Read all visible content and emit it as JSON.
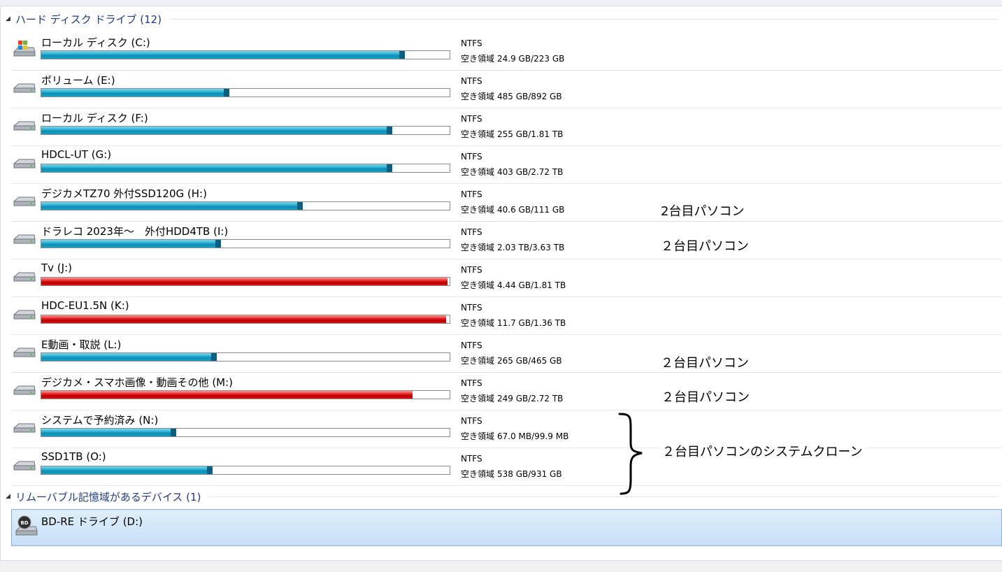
{
  "groups": {
    "hdd_header": "ハード ディスク ドライブ (12)",
    "removable_header": "リムーバブル記憶域があるデバイス (1)"
  },
  "drives": [
    {
      "name": "ローカル ディスク (C:)",
      "fs": "NTFS",
      "space_label": "空き領域",
      "space": "24.9 GB/223 GB",
      "used_fraction": 0.89,
      "color": "blue",
      "icon": "windows-drive-icon"
    },
    {
      "name": "ボリューム (E:)",
      "fs": "NTFS",
      "space_label": "空き領域",
      "space": "485 GB/892 GB",
      "used_fraction": 0.46,
      "color": "blue",
      "icon": "hard-drive-icon"
    },
    {
      "name": "ローカル ディスク (F:)",
      "fs": "NTFS",
      "space_label": "空き領域",
      "space": "255 GB/1.81 TB",
      "used_fraction": 0.86,
      "color": "blue",
      "icon": "hard-drive-icon"
    },
    {
      "name": "HDCL-UT (G:)",
      "fs": "NTFS",
      "space_label": "空き領域",
      "space": "403 GB/2.72 TB",
      "used_fraction": 0.86,
      "color": "blue",
      "icon": "hard-drive-icon"
    },
    {
      "name": "デジカメTZ70 外付SSD120G (H:)",
      "fs": "NTFS",
      "space_label": "空き領域",
      "space": "40.6 GB/111 GB",
      "used_fraction": 0.64,
      "color": "blue",
      "icon": "hard-drive-icon"
    },
    {
      "name": "ドラレコ 2023年～　外付HDD4TB (I:)",
      "fs": "NTFS",
      "space_label": "空き領域",
      "space": "2.03 TB/3.63 TB",
      "used_fraction": 0.44,
      "color": "blue",
      "icon": "hard-drive-icon"
    },
    {
      "name": "Tv (J:)",
      "fs": "NTFS",
      "space_label": "空き領域",
      "space": "4.44 GB/1.81 TB",
      "used_fraction": 0.995,
      "color": "red",
      "icon": "hard-drive-icon"
    },
    {
      "name": "HDC-EU1.5N (K:)",
      "fs": "NTFS",
      "space_label": "空き領域",
      "space": "11.7 GB/1.36 TB",
      "used_fraction": 0.992,
      "color": "red",
      "icon": "hard-drive-icon"
    },
    {
      "name": "E動画・取説 (L:)",
      "fs": "NTFS",
      "space_label": "空き領域",
      "space": "265 GB/465 GB",
      "used_fraction": 0.43,
      "color": "blue",
      "icon": "hard-drive-icon"
    },
    {
      "name": "デジカメ・スマホ画像・動画その他 (M:)",
      "fs": "NTFS",
      "space_label": "空き領域",
      "space": "249 GB/2.72 TB",
      "used_fraction": 0.91,
      "color": "red",
      "icon": "hard-drive-icon"
    },
    {
      "name": "システムで予約済み (N:)",
      "fs": "NTFS",
      "space_label": "空き領域",
      "space": "67.0 MB/99.9 MB",
      "used_fraction": 0.33,
      "color": "blue",
      "icon": "hard-drive-icon"
    },
    {
      "name": "SSD1TB (O:)",
      "fs": "NTFS",
      "space_label": "空き領域",
      "space": "538 GB/931 GB",
      "used_fraction": 0.42,
      "color": "blue",
      "icon": "hard-drive-icon"
    }
  ],
  "removable": {
    "name": "BD-RE ドライブ (D:)",
    "icon": "bd-drive-icon"
  },
  "notes": {
    "h": "2台目パソコン",
    "i": "２台目パソコン",
    "l": "２台目パソコン",
    "m": "２台目パソコン",
    "clone": "２台目パソコンのシステムクローン"
  }
}
